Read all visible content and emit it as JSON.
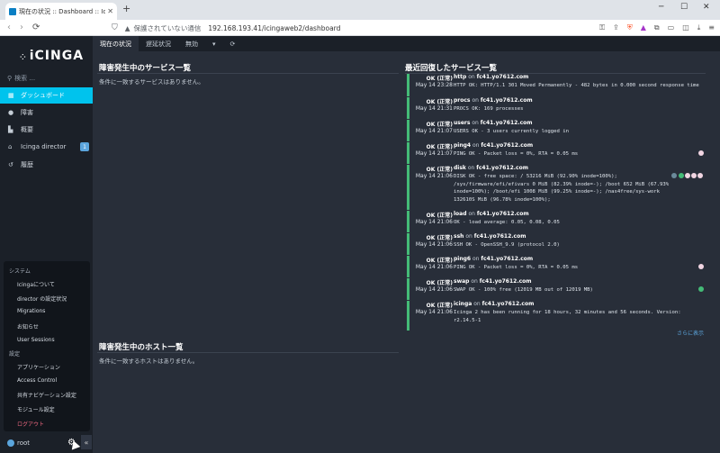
{
  "browser": {
    "tab_title": "現在の状況 :: Dashboard :: Icin",
    "new_tab": "+",
    "address_warning": "保護されていない通信",
    "url": "192.168.193.41/icingaweb2/dashboard"
  },
  "sidebar": {
    "logo_text": "iCINGA",
    "search_placeholder": "検索 ...",
    "items": [
      {
        "label": "ダッシュボード",
        "icon": "dashboard-icon",
        "active": true
      },
      {
        "label": "障害",
        "icon": "problems-icon",
        "active": false
      },
      {
        "label": "概要",
        "icon": "overview-icon",
        "active": false
      },
      {
        "label": "Icinga director",
        "icon": "director-icon",
        "active": false,
        "badge": "1"
      },
      {
        "label": "履歴",
        "icon": "history-icon",
        "active": false
      }
    ],
    "flyout": {
      "system_header": "システム",
      "system_items": [
        "Icingaについて",
        "director の設定状況",
        "Migrations",
        "お知らせ",
        "User Sessions"
      ],
      "config_header": "設定",
      "config_items": [
        "アプリケーション",
        "Access Control",
        "共有ナビゲーション設定",
        "モジュール設定"
      ],
      "logout": "ログアウト"
    },
    "user": "root"
  },
  "tabs": [
    "現在の状況",
    "遅延状況",
    "無効",
    "▾",
    "⟳"
  ],
  "main": {
    "left_title_1": "障害発生中のサービス一覧",
    "left_sub_1": "条件に一致するサービスはありません。",
    "left_title_2": "障害発生中のホスト一覧",
    "left_sub_2": "条件に一致するホストはありません。",
    "right_title": "最近回復したサービス一覧",
    "on": "on",
    "more_link": "さらに表示",
    "services": [
      {
        "state": "OK (正常)",
        "time": "May 14 23:28",
        "name": "http",
        "host": "fc41.yo7612.com",
        "output": "HTTP OK: HTTP/1.1 301 Moved Permanently - 482 bytes in 0.000 second response time",
        "dot": ""
      },
      {
        "state": "OK (正常)",
        "time": "May 14 21:31",
        "name": "procs",
        "host": "fc41.yo7612.com",
        "output": "PROCS OK: 169 processes",
        "dot": ""
      },
      {
        "state": "OK (正常)",
        "time": "May 14 21:07",
        "name": "users",
        "host": "fc41.yo7612.com",
        "output": "USERS OK - 3 users currently logged in",
        "dot": ""
      },
      {
        "state": "OK (正常)",
        "time": "May 14 21:07",
        "name": "ping4",
        "host": "fc41.yo7612.com",
        "output": "PING OK - Packet loss = 0%, RTA = 0.05 ms",
        "dot": "pink"
      },
      {
        "state": "OK (正常)",
        "time": "May 14 21:06",
        "name": "disk",
        "host": "fc41.yo7612.com",
        "output": "DISK OK - free space: / 53216 MiB (92.90% inode=100%); /sys/firmware/efi/efivars 0 MiB (82.39% inode=-); /boot 652 MiB (67.93% inode=100%); /boot/efi 1008 MiB (99.25% inode=-); /nas4free/sys-work 132610S MiB (96.78% inode=100%);",
        "dot": "multi"
      },
      {
        "state": "OK (正常)",
        "time": "May 14 21:06",
        "name": "load",
        "host": "fc41.yo7612.com",
        "output": "OK - load average: 0.05, 0.08, 0.05",
        "dot": ""
      },
      {
        "state": "OK (正常)",
        "time": "May 14 21:06",
        "name": "ssh",
        "host": "fc41.yo7612.com",
        "output": "SSH OK - OpenSSH_9.9 (protocol 2.0)",
        "dot": ""
      },
      {
        "state": "OK (正常)",
        "time": "May 14 21:06",
        "name": "ping6",
        "host": "fc41.yo7612.com",
        "output": "PING OK - Packet loss = 0%, RTA = 0.05 ms",
        "dot": "pink"
      },
      {
        "state": "OK (正常)",
        "time": "May 14 21:06",
        "name": "swap",
        "host": "fc41.yo7612.com",
        "output": "SWAP OK - 100% free (12019 MB out of 12019 MB)",
        "dot": "green"
      },
      {
        "state": "OK (正常)",
        "time": "May 14 21:06",
        "name": "icinga",
        "host": "fc41.yo7612.com",
        "output": "Icinga 2 has been running for 18 hours, 32 minutes and 56 seconds. Version: r2.14.5-1",
        "dot": ""
      }
    ]
  }
}
